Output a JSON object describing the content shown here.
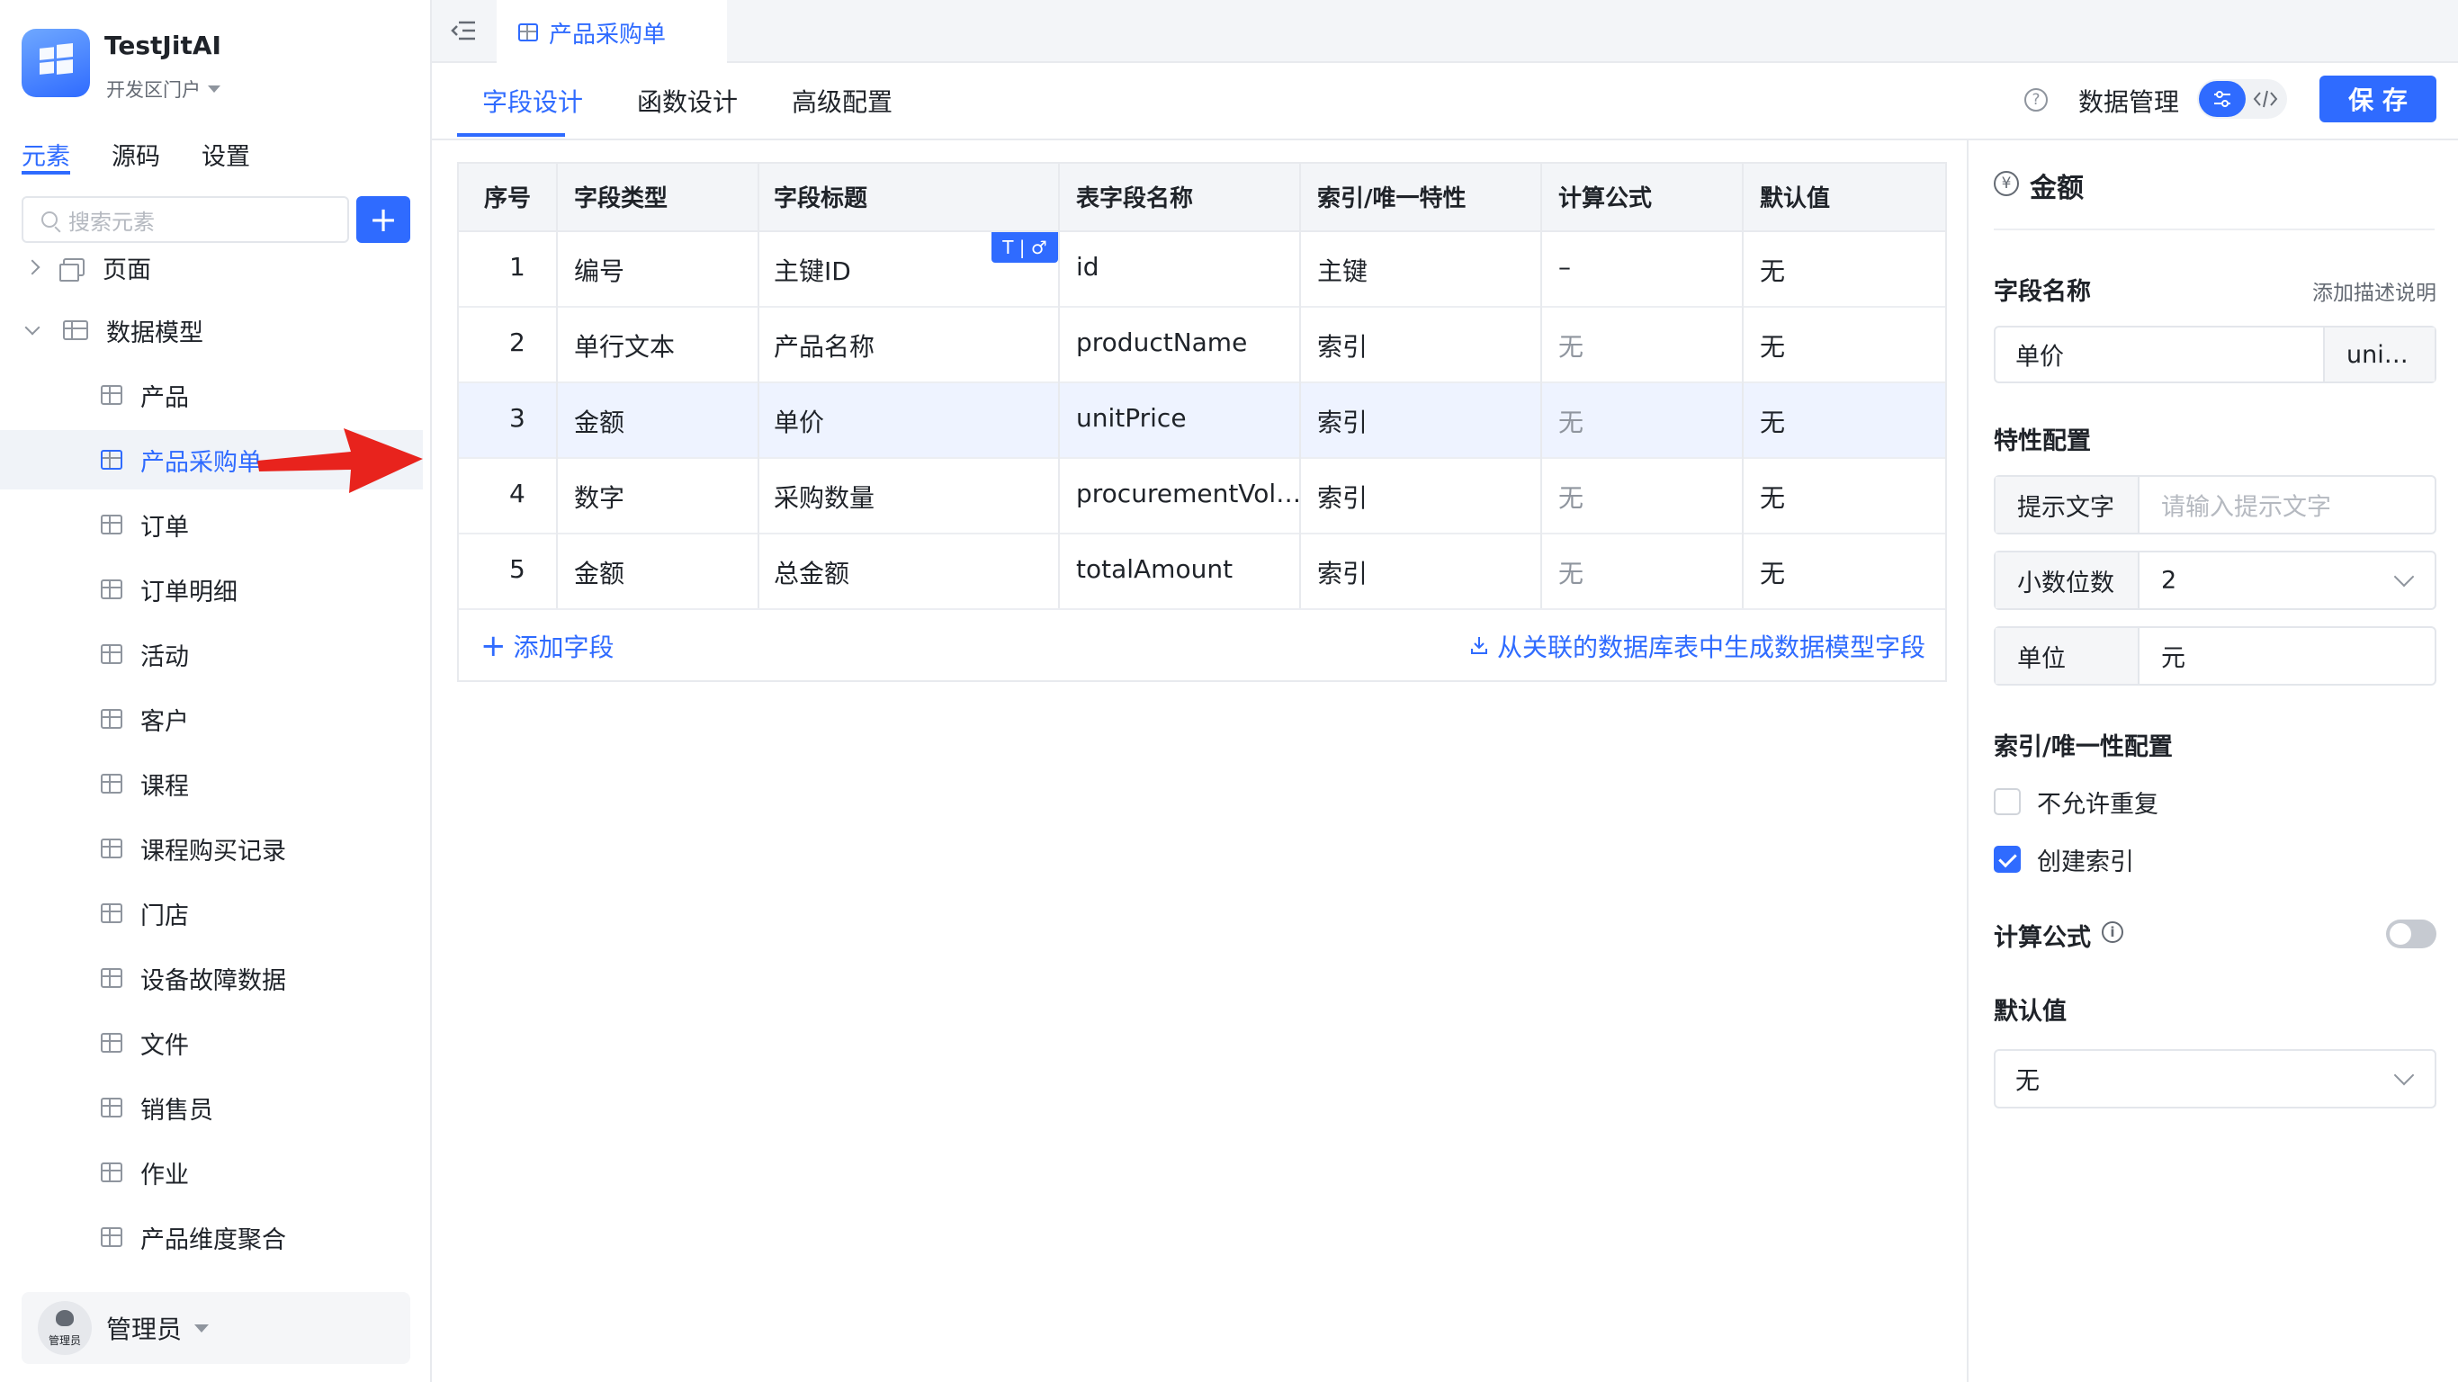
{
  "app": {
    "name": "TestJitAI",
    "portal": "开发区门户"
  },
  "sidebar": {
    "tabs": [
      "元素",
      "源码",
      "设置"
    ],
    "active_tab": 0,
    "search_placeholder": "搜索元素",
    "add_button": "+",
    "tree": [
      {
        "label": "页面",
        "level": 0,
        "expanded": false
      },
      {
        "label": "数据模型",
        "level": 0,
        "expanded": true
      },
      {
        "label": "产品",
        "level": 1
      },
      {
        "label": "产品采购单",
        "level": 1,
        "active": true
      },
      {
        "label": "订单",
        "level": 1
      },
      {
        "label": "订单明细",
        "level": 1
      },
      {
        "label": "活动",
        "level": 1
      },
      {
        "label": "客户",
        "level": 1
      },
      {
        "label": "课程",
        "level": 1
      },
      {
        "label": "课程购买记录",
        "level": 1
      },
      {
        "label": "门店",
        "level": 1
      },
      {
        "label": "设备故障数据",
        "level": 1
      },
      {
        "label": "文件",
        "level": 1
      },
      {
        "label": "销售员",
        "level": 1
      },
      {
        "label": "作业",
        "level": 1
      },
      {
        "label": "产品维度聚合",
        "level": 1
      }
    ],
    "user": {
      "avatar_text": "管理员",
      "name": "管理员"
    }
  },
  "editor": {
    "tab_title": "产品采购单",
    "subtabs": [
      "字段设计",
      "函数设计",
      "高级配置"
    ],
    "active_subtab": 0,
    "toolbar": {
      "data_manage": "数据管理",
      "save": "保 存"
    }
  },
  "table": {
    "headers": [
      "序号",
      "字段类型",
      "字段标题",
      "表字段名称",
      "索引/唯一特性",
      "计算公式",
      "默认值"
    ],
    "badge": "T | ♂",
    "rows": [
      {
        "no": "1",
        "type": "编号",
        "title": "主键ID",
        "name": "id",
        "index": "主键",
        "formula": "–",
        "default": "无"
      },
      {
        "no": "2",
        "type": "单行文本",
        "title": "产品名称",
        "name": "productName",
        "index": "索引",
        "formula": "无",
        "default": "无"
      },
      {
        "no": "3",
        "type": "金额",
        "title": "单价",
        "name": "unitPrice",
        "index": "索引",
        "formula": "无",
        "default": "无",
        "selected": true
      },
      {
        "no": "4",
        "type": "数字",
        "title": "采购数量",
        "name": "procurementVol…",
        "index": "索引",
        "formula": "无",
        "default": "无"
      },
      {
        "no": "5",
        "type": "金额",
        "title": "总金额",
        "name": "totalAmount",
        "index": "索引",
        "formula": "无",
        "default": "无"
      }
    ],
    "add_field": "添加字段",
    "generate_link": "从关联的数据库表中生成数据模型字段"
  },
  "panel": {
    "title": "金额",
    "field_name_label": "字段名称",
    "add_description": "添加描述说明",
    "field_title_value": "单价",
    "field_name_value": "uni…",
    "feature_label": "特性配置",
    "hint_label": "提示文字",
    "hint_placeholder": "请输入提示文字",
    "decimal_label": "小数位数",
    "decimal_value": "2",
    "unit_label": "单位",
    "unit_value": "元",
    "index_label": "索引/唯一性配置",
    "no_duplicate": "不允许重复",
    "create_index": "创建索引",
    "formula_label": "计算公式",
    "default_label": "默认值",
    "default_value": "无"
  },
  "colors": {
    "accent": "#2f6bff",
    "arrow": "#e8231d",
    "border": "#e8eaee"
  }
}
